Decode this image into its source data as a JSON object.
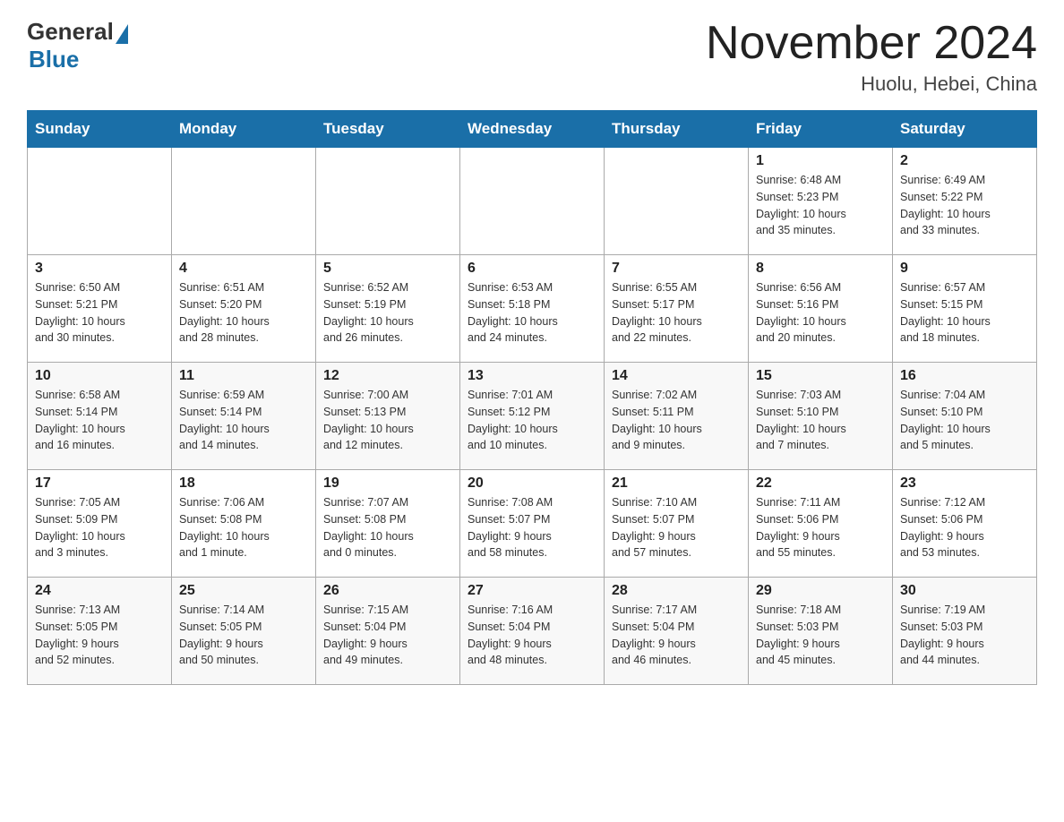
{
  "header": {
    "logo_general": "General",
    "logo_blue": "Blue",
    "month_title": "November 2024",
    "location": "Huolu, Hebei, China"
  },
  "weekdays": [
    "Sunday",
    "Monday",
    "Tuesday",
    "Wednesday",
    "Thursday",
    "Friday",
    "Saturday"
  ],
  "weeks": [
    [
      {
        "day": "",
        "info": ""
      },
      {
        "day": "",
        "info": ""
      },
      {
        "day": "",
        "info": ""
      },
      {
        "day": "",
        "info": ""
      },
      {
        "day": "",
        "info": ""
      },
      {
        "day": "1",
        "info": "Sunrise: 6:48 AM\nSunset: 5:23 PM\nDaylight: 10 hours\nand 35 minutes."
      },
      {
        "day": "2",
        "info": "Sunrise: 6:49 AM\nSunset: 5:22 PM\nDaylight: 10 hours\nand 33 minutes."
      }
    ],
    [
      {
        "day": "3",
        "info": "Sunrise: 6:50 AM\nSunset: 5:21 PM\nDaylight: 10 hours\nand 30 minutes."
      },
      {
        "day": "4",
        "info": "Sunrise: 6:51 AM\nSunset: 5:20 PM\nDaylight: 10 hours\nand 28 minutes."
      },
      {
        "day": "5",
        "info": "Sunrise: 6:52 AM\nSunset: 5:19 PM\nDaylight: 10 hours\nand 26 minutes."
      },
      {
        "day": "6",
        "info": "Sunrise: 6:53 AM\nSunset: 5:18 PM\nDaylight: 10 hours\nand 24 minutes."
      },
      {
        "day": "7",
        "info": "Sunrise: 6:55 AM\nSunset: 5:17 PM\nDaylight: 10 hours\nand 22 minutes."
      },
      {
        "day": "8",
        "info": "Sunrise: 6:56 AM\nSunset: 5:16 PM\nDaylight: 10 hours\nand 20 minutes."
      },
      {
        "day": "9",
        "info": "Sunrise: 6:57 AM\nSunset: 5:15 PM\nDaylight: 10 hours\nand 18 minutes."
      }
    ],
    [
      {
        "day": "10",
        "info": "Sunrise: 6:58 AM\nSunset: 5:14 PM\nDaylight: 10 hours\nand 16 minutes."
      },
      {
        "day": "11",
        "info": "Sunrise: 6:59 AM\nSunset: 5:14 PM\nDaylight: 10 hours\nand 14 minutes."
      },
      {
        "day": "12",
        "info": "Sunrise: 7:00 AM\nSunset: 5:13 PM\nDaylight: 10 hours\nand 12 minutes."
      },
      {
        "day": "13",
        "info": "Sunrise: 7:01 AM\nSunset: 5:12 PM\nDaylight: 10 hours\nand 10 minutes."
      },
      {
        "day": "14",
        "info": "Sunrise: 7:02 AM\nSunset: 5:11 PM\nDaylight: 10 hours\nand 9 minutes."
      },
      {
        "day": "15",
        "info": "Sunrise: 7:03 AM\nSunset: 5:10 PM\nDaylight: 10 hours\nand 7 minutes."
      },
      {
        "day": "16",
        "info": "Sunrise: 7:04 AM\nSunset: 5:10 PM\nDaylight: 10 hours\nand 5 minutes."
      }
    ],
    [
      {
        "day": "17",
        "info": "Sunrise: 7:05 AM\nSunset: 5:09 PM\nDaylight: 10 hours\nand 3 minutes."
      },
      {
        "day": "18",
        "info": "Sunrise: 7:06 AM\nSunset: 5:08 PM\nDaylight: 10 hours\nand 1 minute."
      },
      {
        "day": "19",
        "info": "Sunrise: 7:07 AM\nSunset: 5:08 PM\nDaylight: 10 hours\nand 0 minutes."
      },
      {
        "day": "20",
        "info": "Sunrise: 7:08 AM\nSunset: 5:07 PM\nDaylight: 9 hours\nand 58 minutes."
      },
      {
        "day": "21",
        "info": "Sunrise: 7:10 AM\nSunset: 5:07 PM\nDaylight: 9 hours\nand 57 minutes."
      },
      {
        "day": "22",
        "info": "Sunrise: 7:11 AM\nSunset: 5:06 PM\nDaylight: 9 hours\nand 55 minutes."
      },
      {
        "day": "23",
        "info": "Sunrise: 7:12 AM\nSunset: 5:06 PM\nDaylight: 9 hours\nand 53 minutes."
      }
    ],
    [
      {
        "day": "24",
        "info": "Sunrise: 7:13 AM\nSunset: 5:05 PM\nDaylight: 9 hours\nand 52 minutes."
      },
      {
        "day": "25",
        "info": "Sunrise: 7:14 AM\nSunset: 5:05 PM\nDaylight: 9 hours\nand 50 minutes."
      },
      {
        "day": "26",
        "info": "Sunrise: 7:15 AM\nSunset: 5:04 PM\nDaylight: 9 hours\nand 49 minutes."
      },
      {
        "day": "27",
        "info": "Sunrise: 7:16 AM\nSunset: 5:04 PM\nDaylight: 9 hours\nand 48 minutes."
      },
      {
        "day": "28",
        "info": "Sunrise: 7:17 AM\nSunset: 5:04 PM\nDaylight: 9 hours\nand 46 minutes."
      },
      {
        "day": "29",
        "info": "Sunrise: 7:18 AM\nSunset: 5:03 PM\nDaylight: 9 hours\nand 45 minutes."
      },
      {
        "day": "30",
        "info": "Sunrise: 7:19 AM\nSunset: 5:03 PM\nDaylight: 9 hours\nand 44 minutes."
      }
    ]
  ]
}
